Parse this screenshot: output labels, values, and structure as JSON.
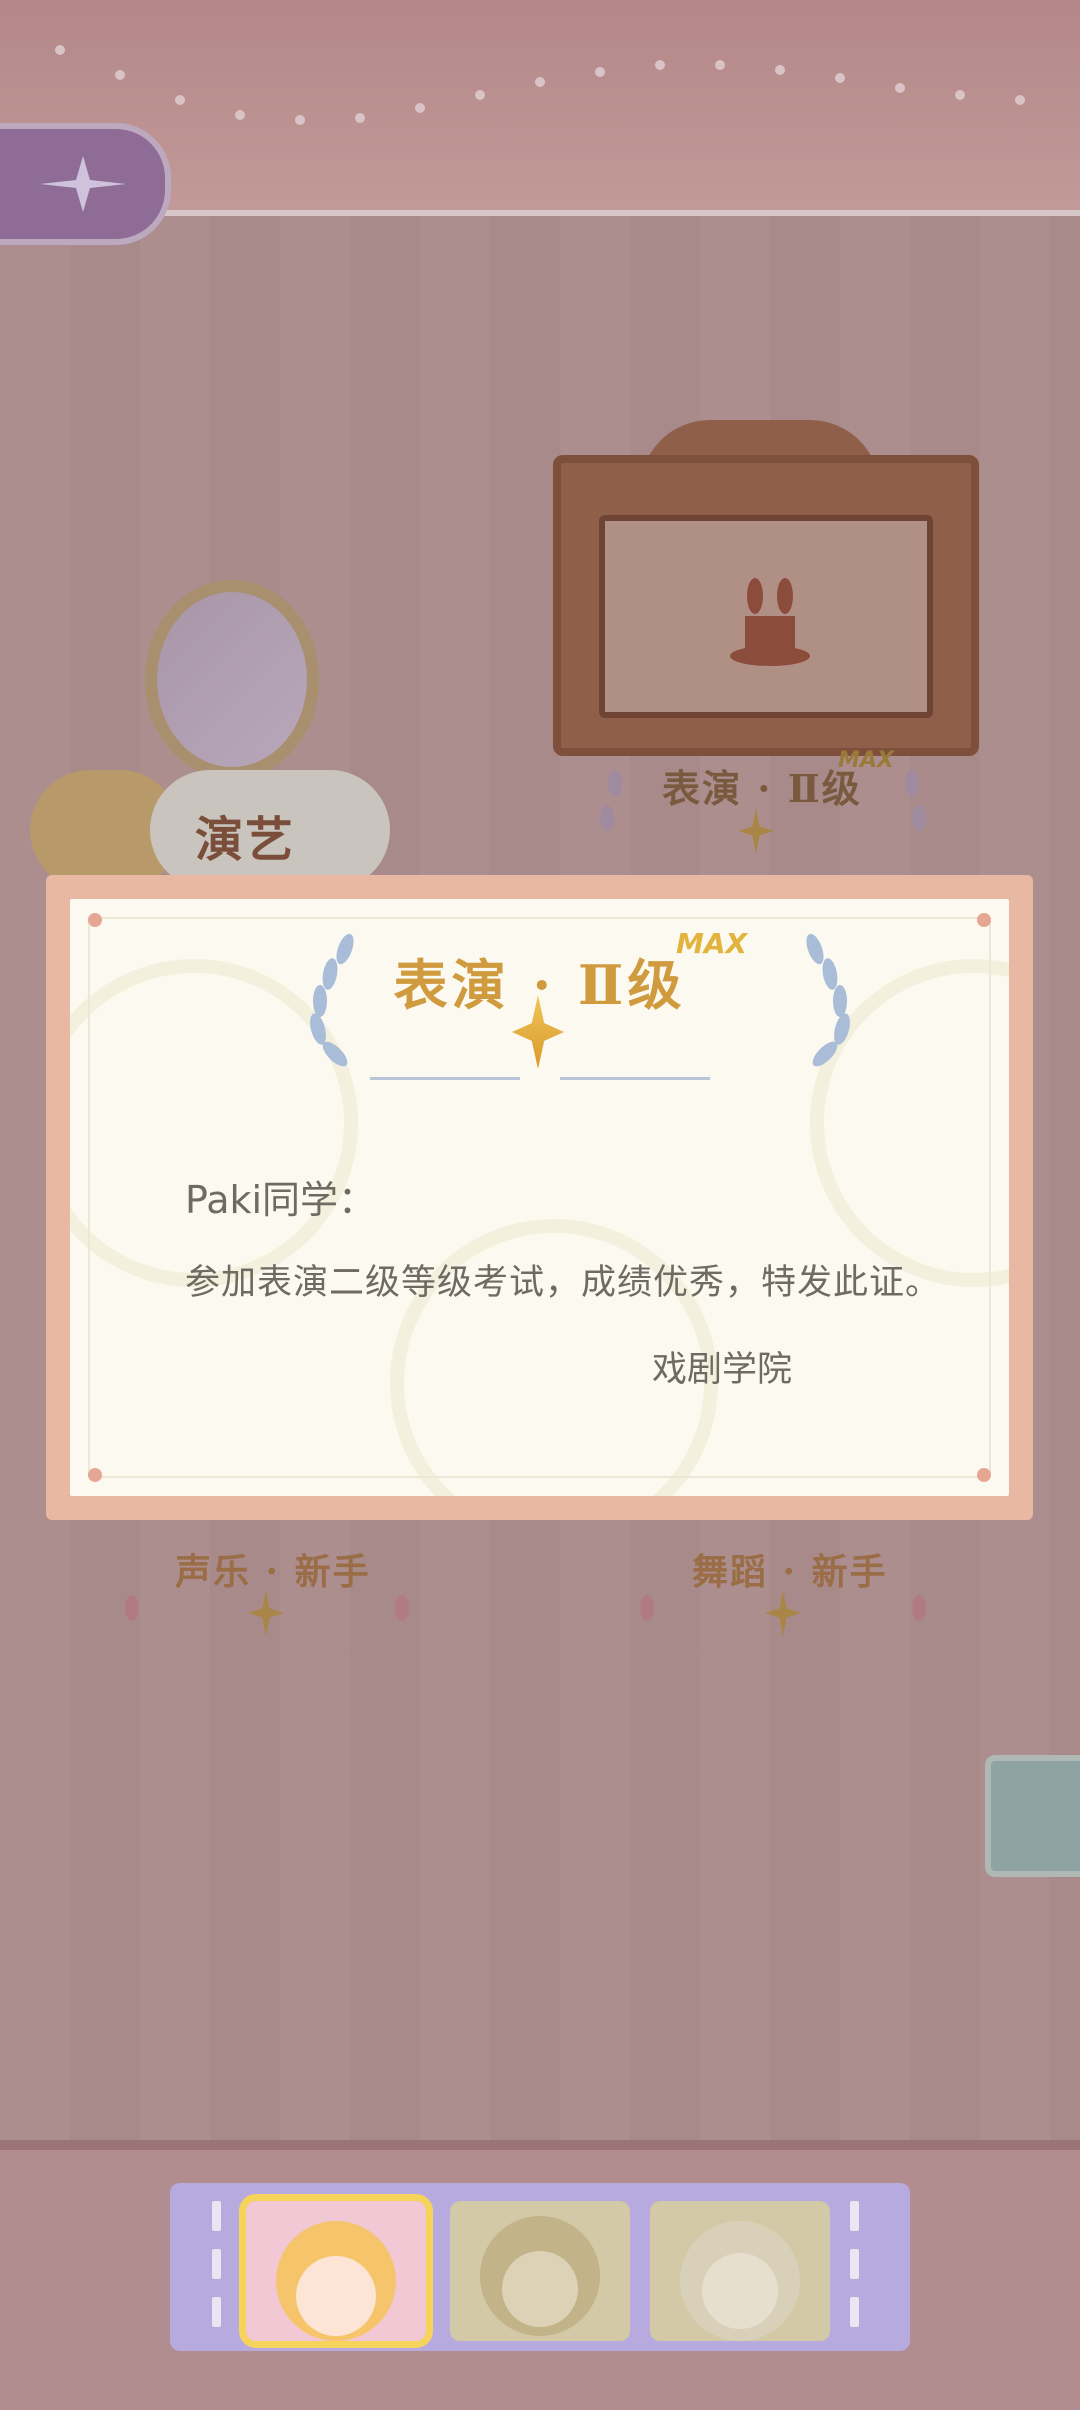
{
  "header": {
    "back_icon": "compass-star-icon"
  },
  "room": {
    "sign_text": "演艺",
    "skills": [
      {
        "name": "表演 · Ⅱ级",
        "badge": "MAX"
      },
      {
        "name": "声乐 · 新手"
      },
      {
        "name": "舞蹈 · 新手"
      }
    ]
  },
  "certificate": {
    "title": "表演 · Ⅱ级",
    "badge": "MAX",
    "greeting": "Paki同学：",
    "body": "参加表演二级等级考试，成绩优秀，特发此证。",
    "signature": "戏剧学院"
  },
  "character_bar": {
    "slots": [
      {
        "name": "orange-haired-girl-avatar",
        "active": true
      },
      {
        "name": "brown-haired-boy-avatar",
        "active": false
      },
      {
        "name": "bear-ear-girl-avatar",
        "active": false
      }
    ]
  },
  "colors": {
    "accent_gold": "#cf9b3e",
    "bar_lavender": "#b7aade",
    "active_outline": "#f6d35a"
  }
}
